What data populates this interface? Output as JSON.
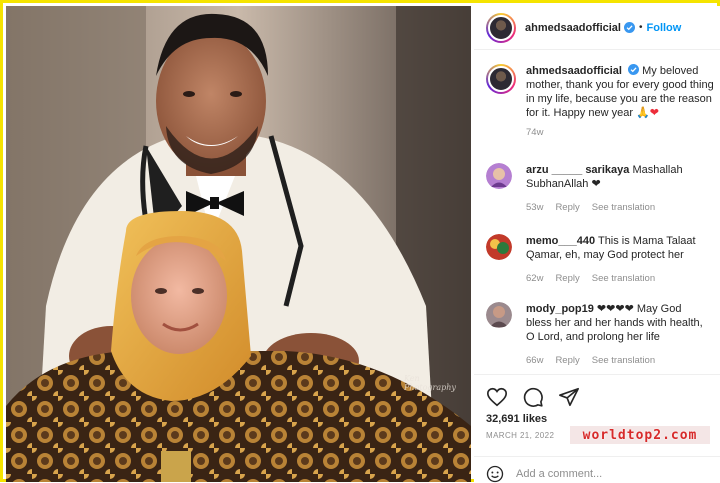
{
  "post": {
    "photo_credit": "Ken Photography",
    "header": {
      "username": "ahmedsaadofficial",
      "separator": "•",
      "follow_label": "Follow"
    },
    "caption": {
      "username": "ahmedsaadofficial",
      "text": "My beloved mother, thank you for every good thing in my life, because you are the reason for it. Happy new year",
      "emoji": "🙏❤",
      "time": "74w"
    },
    "comments": [
      {
        "username": "arzu _____ sarikaya",
        "text": "Mashallah SubhanAllah ❤",
        "time": "53w",
        "reply_label": "Reply",
        "translate_label": "See translation"
      },
      {
        "username": "memo___440",
        "text": "This is Mama Talaat Qamar, eh, may God protect her",
        "time": "62w",
        "reply_label": "Reply",
        "translate_label": "See translation"
      },
      {
        "username": "mody_pop19",
        "text": "❤❤❤❤ May God bless her and her hands with health, O Lord, and prolong her life",
        "time": "66w",
        "reply_label": "Reply",
        "translate_label": "See translation"
      }
    ],
    "likes": "32,691 likes",
    "date": "MARCH 21, 2022",
    "watermark": "worldtop2.com",
    "add_comment_placeholder": "Add a comment..."
  },
  "colors": {
    "frame": "#f5e400",
    "link_blue": "#0095f6",
    "verified_blue": "#3897f0",
    "heart_red": "#ed2d3a",
    "muted": "#8e8e8e"
  },
  "icons": {
    "like": "heart-outline-icon",
    "comment": "speech-bubble-icon",
    "share": "paper-plane-icon",
    "verified": "verified-badge-icon",
    "emoji": "smiley-icon"
  }
}
